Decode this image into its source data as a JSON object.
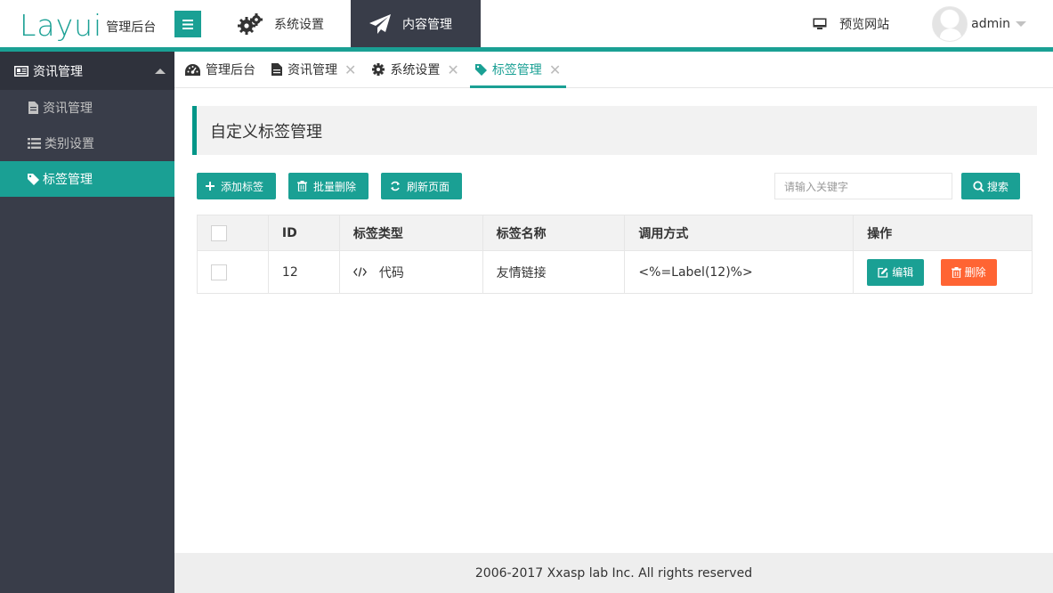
{
  "header": {
    "logo_text": "Layui",
    "logo_sub": "管理后台",
    "nav": [
      {
        "label": "系统设置",
        "icon": "gears-icon"
      },
      {
        "label": "内容管理",
        "icon": "paper-plane-icon"
      }
    ],
    "preview_label": "预览网站",
    "user_name": "admin"
  },
  "sidebar": {
    "group_label": "资讯管理",
    "items": [
      {
        "label": "资讯管理",
        "icon": "file-icon"
      },
      {
        "label": "类别设置",
        "icon": "list-icon"
      },
      {
        "label": "标签管理",
        "icon": "tag-icon"
      }
    ]
  },
  "tabs": [
    {
      "label": "管理后台",
      "icon": "dashboard-icon"
    },
    {
      "label": "资讯管理",
      "icon": "file-icon"
    },
    {
      "label": "系统设置",
      "icon": "gear-icon"
    },
    {
      "label": "标签管理",
      "icon": "tag-icon"
    }
  ],
  "page": {
    "title": "自定义标签管理",
    "buttons": {
      "add": "添加标签",
      "batch_delete": "批量删除",
      "refresh": "刷新页面"
    },
    "search_placeholder": "请输入关键字",
    "search_label": "搜索"
  },
  "table": {
    "headers": [
      "ID",
      "标签类型",
      "标签名称",
      "调用方式",
      "操作"
    ],
    "rows": [
      {
        "id": "12",
        "type": "代码",
        "name": "友情链接",
        "call": "<%=Label(12)%>",
        "edit": "编辑",
        "delete": "删除"
      }
    ]
  },
  "footer": {
    "text": "2006-2017 Xxasp lab Inc. All rights reserved"
  },
  "colors": {
    "accent": "#1aa094",
    "dark": "#393d49",
    "danger": "#ff5722"
  }
}
